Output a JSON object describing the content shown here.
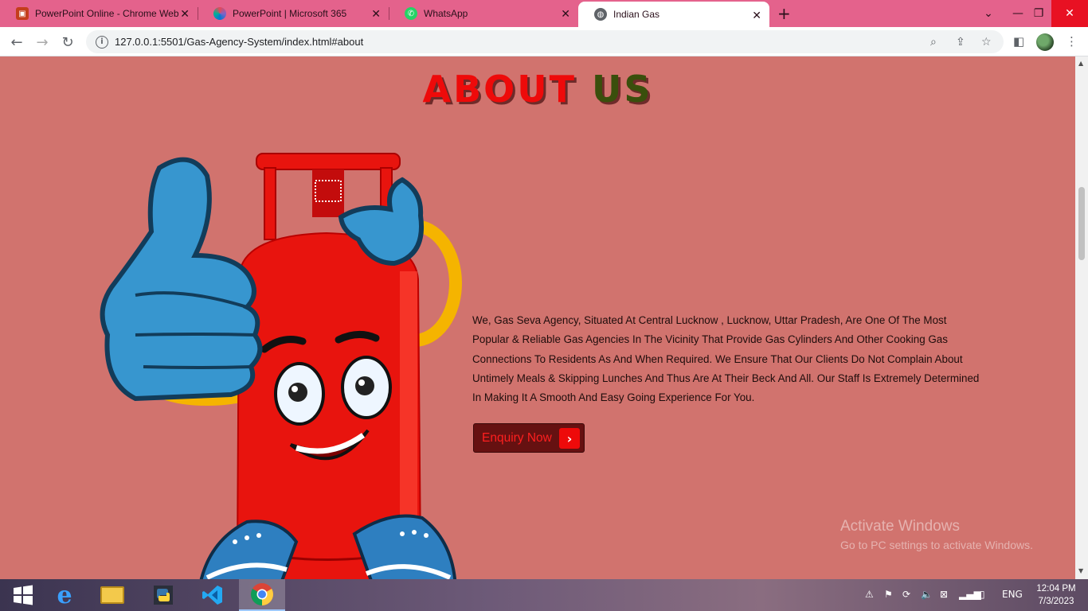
{
  "browser": {
    "tabs": [
      {
        "title": "PowerPoint Online - Chrome Web Store",
        "favicon": "powerpoint-store-icon",
        "active": false
      },
      {
        "title": "PowerPoint | Microsoft 365",
        "favicon": "microsoft365-icon",
        "active": false
      },
      {
        "title": "WhatsApp",
        "favicon": "whatsapp-icon",
        "active": false
      },
      {
        "title": "Indian Gas",
        "favicon": "globe-icon",
        "active": true
      }
    ],
    "url": "127.0.0.1:5501/Gas-Agency-System/index.html#about"
  },
  "about": {
    "title_part1": "ABOUT",
    "title_part2": "US",
    "paragraph": "We, Gas Seva Agency, Situated At Central Lucknow , Lucknow, Uttar Pradesh, Are One Of The Most Popular & Reliable Gas Agencies In The Vicinity That Provide Gas Cylinders And Other Cooking Gas Connections To Residents As And When Required. We Ensure That Our Clients Do Not Complain About Untimely Meals & Skipping Lunches And Thus Are At Their Beck And All. Our Staff Is Extremely Determined In Making It A Smooth And Easy Going Experience For You.",
    "button_label": "Enquiry Now"
  },
  "watermark": {
    "line1": "Activate Windows",
    "line2": "Go to PC settings to activate Windows."
  },
  "taskbar": {
    "language": "ENG",
    "time": "12:04 PM",
    "date": "7/3/2023"
  },
  "colors": {
    "page_bg": "#d1736e",
    "title_red": "#ee0a0a",
    "title_green": "#3a4f0c",
    "tabstrip": "#e4628c",
    "button_bg": "#661111"
  }
}
